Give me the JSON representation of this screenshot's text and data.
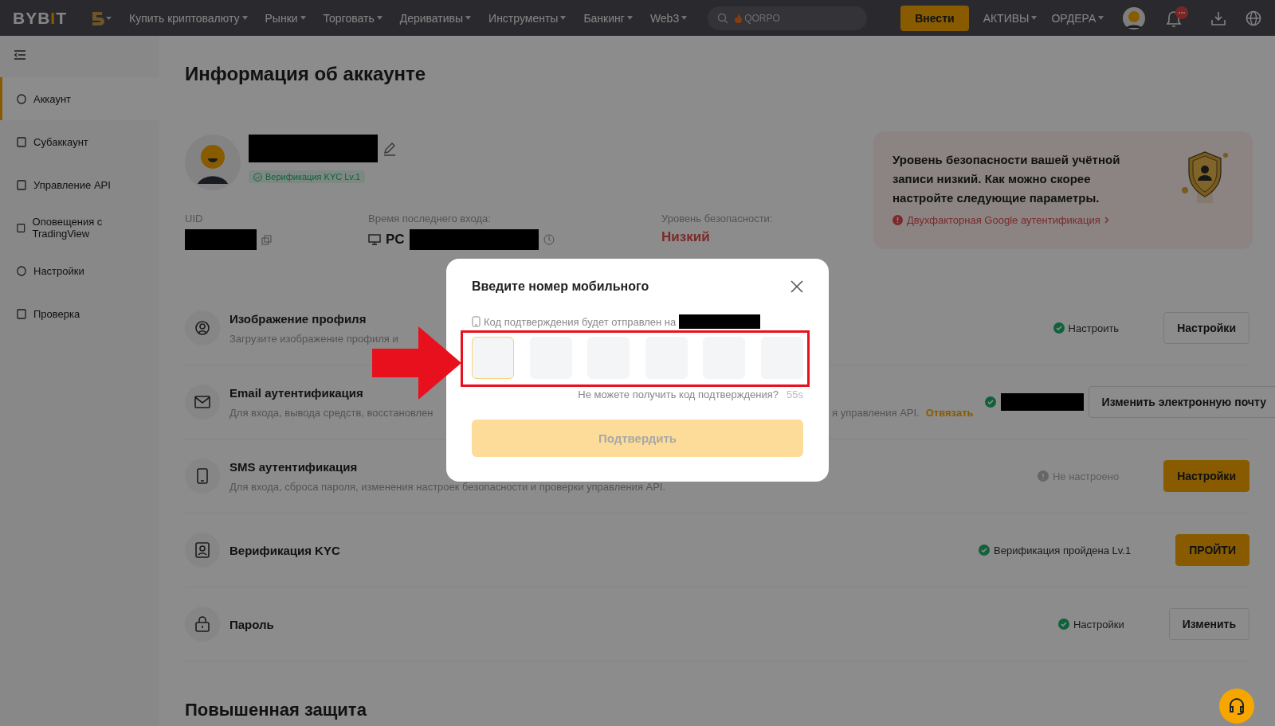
{
  "header": {
    "logo": "BYBIT",
    "nav": [
      "Купить криптовалюту",
      "Рынки",
      "Торговать",
      "Деривативы",
      "Инструменты",
      "Банкинг",
      "Web3"
    ],
    "search": {
      "placeholder": "QORPO"
    },
    "deposit_button": "Внести",
    "menus": [
      "АКТИВЫ",
      "ОРДЕРА"
    ]
  },
  "sidebar": {
    "items": [
      {
        "label": "Аккаунт",
        "selected": true
      },
      {
        "label": "Субаккаунт",
        "selected": false
      },
      {
        "label": "Управление API",
        "selected": false
      },
      {
        "label": "Оповещения с TradingView",
        "selected": false
      },
      {
        "label": "Настройки",
        "selected": false
      },
      {
        "label": "Проверка",
        "selected": false
      }
    ]
  },
  "account": {
    "title": "Информация об аккаунте",
    "kyc_badge": "Верификация KYC Lv.1",
    "uid_label": "UID",
    "last_login_label": "Время последнего входа:",
    "device": "PC",
    "security_label": "Уровень безопасности:",
    "security_value": "Низкий"
  },
  "security_card": {
    "text": "Уровень безопасности вашей учётной записи низкий. Как можно скорее настройте следующие параметры.",
    "link": "Двухфакторная Google аутентификация"
  },
  "rows": [
    {
      "title": "Изображение профиля",
      "description": "Загрузите изображение профиля и",
      "status": {
        "text": "Настроить",
        "kind": "ok"
      },
      "button": {
        "label": "Настройки",
        "kind": "outline"
      }
    },
    {
      "title": "Email аутентификация",
      "description": "Для входа, вывода средств, восстановлен",
      "description_tail": "я управления API.",
      "link": "Отвязать",
      "status": {
        "kind": "ok"
      },
      "redacted": true,
      "button": {
        "label": "Изменить электронную почту",
        "kind": "outline"
      }
    },
    {
      "title": "SMS аутентификация",
      "description": "Для входа, сброса пароля, изменения настроек безопасности и проверки управления API.",
      "status": {
        "text": "Не настроено",
        "kind": "warn"
      },
      "button": {
        "label": "Настройки",
        "kind": "primary"
      }
    },
    {
      "title": "Верификация KYC",
      "status": {
        "text": "Верификация пройдена Lv.1",
        "kind": "ok"
      },
      "button": {
        "label": "ПРОЙТИ",
        "kind": "primary"
      }
    },
    {
      "title": "Пароль",
      "status": {
        "text": "Настройки",
        "kind": "ok"
      },
      "button": {
        "label": "Изменить",
        "kind": "outline"
      }
    }
  ],
  "section_heading": "Повышенная защита",
  "modal": {
    "title": "Введите номер мобильного",
    "hint": "Код подтверждения будет отправлен на",
    "code_boxes": [
      {
        "selected": true
      },
      {
        "selected": false
      },
      {
        "selected": false
      },
      {
        "selected": false
      },
      {
        "selected": false
      },
      {
        "selected": false
      }
    ],
    "resend": "Не можете получить код подтверждения?",
    "timer": "55s",
    "submit": "Подтвердить",
    "submit_disabled": true
  }
}
